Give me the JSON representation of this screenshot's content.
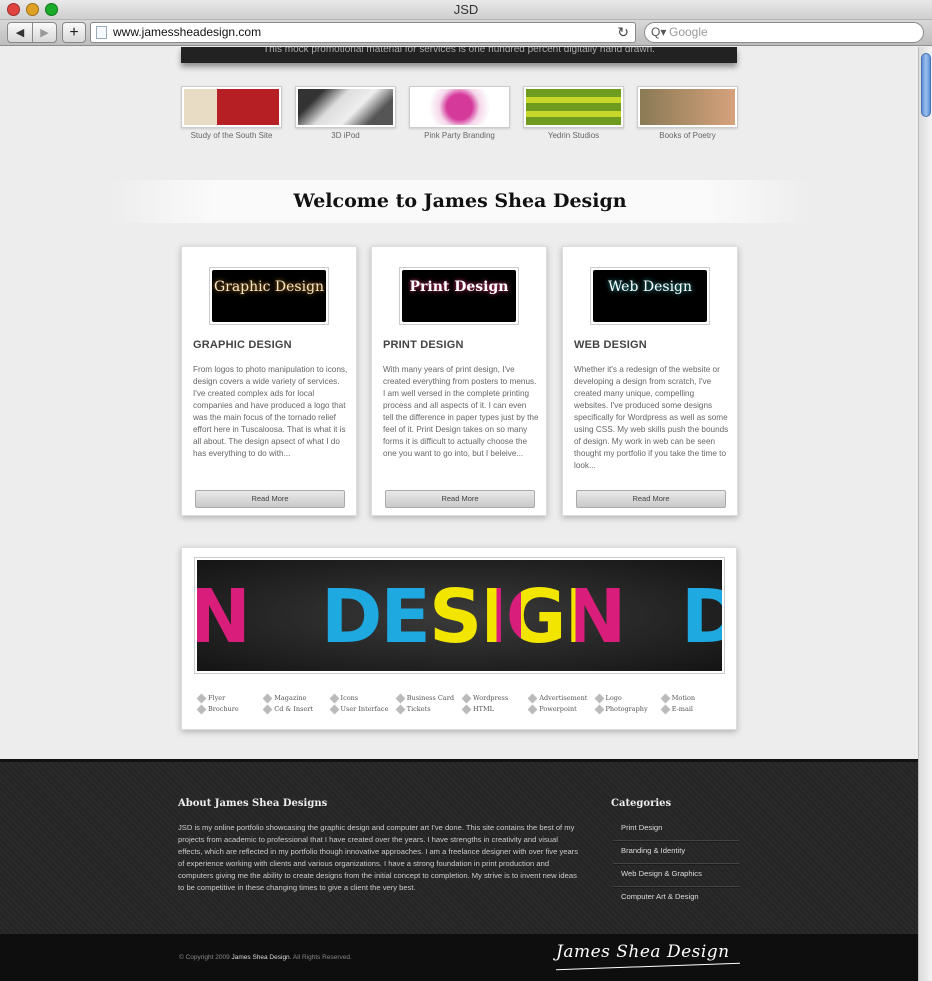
{
  "window": {
    "title": "JSD"
  },
  "browser": {
    "back_label": "◀",
    "forward_label": "▶",
    "add_label": "+",
    "url": "www.jamessheadesign.com",
    "reload_label": "↻",
    "search_placeholder": "Google",
    "search_icon": "Q▾"
  },
  "slider": {
    "caption": "This mock promotional material for services is one hundred percent digitally hand drawn."
  },
  "portfolio": [
    {
      "label": "Study of the South Site",
      "color": "#b62024"
    },
    {
      "label": "3D iPod",
      "color": "#777777"
    },
    {
      "label": "Pink Party Branding",
      "color": "#d53a9b"
    },
    {
      "label": "Yedrin Studios",
      "color": "#6f9b1e"
    },
    {
      "label": "Books of Poetry",
      "color": "#b98558"
    }
  ],
  "welcome": {
    "heading": "Welcome to James Shea Design"
  },
  "services": [
    {
      "logo": "Graphic Design",
      "title": "GRAPHIC DESIGN",
      "text": "From logos to photo manipulation to icons, design covers a wide variety of services. I've created complex ads for local companies and have produced a logo that was the main focus of the tornado relief effort here in Tuscaloosa. That is what it is all about. The design apsect of what I do has everything to do with...",
      "button": "Read More"
    },
    {
      "logo": "Print Design",
      "title": "PRINT DESIGN",
      "text": "With many years of print design, I've created everything from posters to menus. I am well versed in the complete printing process and all aspects of it. I can even tell the difference in paper types just by the feel of it. Print Design takes on so many forms it is difficult to actually choose the one you want to go into, but I beleive...",
      "button": "Read More"
    },
    {
      "logo": "Web Design",
      "title": "WEB DESIGN",
      "text": "Whether it's a redesign of the website or developing a design from scratch, I've created many unique, compelling websites. I've produced some designs specifically for Wordpress as well as some using CSS. My web skills push the bounds of design. My work in web can be seen thought my portfolio if you take the time to look...",
      "button": "Read More"
    }
  ],
  "banner": {
    "word": "DESIGN",
    "left_letter": "N",
    "right_letter": "D"
  },
  "tags": [
    "Flyer",
    "Magazine",
    "Icons",
    "Business Card",
    "Wordpress",
    "Advertisement",
    "Logo",
    "Motion",
    "Brochure",
    "Cd & Insert",
    "User Interface",
    "Tickets",
    "HTML",
    "Powerpoint",
    "Photography",
    "E-mail"
  ],
  "footer": {
    "about_heading": "About James Shea Designs",
    "about_text": "JSD is my online portfolio showcasing the graphic design and computer art I've done. This site contains the best of my projects from academic to professional that I have created over the years. I have strengths in creativity and visual effects, which are reflected in my portfolio though innovative approaches. I am a freelance designer with over five years of experience working with clients and various organizations. I have a strong foundation in print production and computers giving me the ability to create designs from the initial concept to completion. My strive is to invent new ideas to be competitive in these changing times to give a client the very best.",
    "categories_heading": "Categories",
    "categories": [
      "Print Design",
      "Branding & Identity",
      "Web Design & Graphics",
      "Computer Art & Design"
    ],
    "copyright_prefix": "© Copyright 2009",
    "copyright_name": "James Shea Design",
    "copyright_suffix": ". All Rights Reserved.",
    "signature": "James Shea Design"
  }
}
